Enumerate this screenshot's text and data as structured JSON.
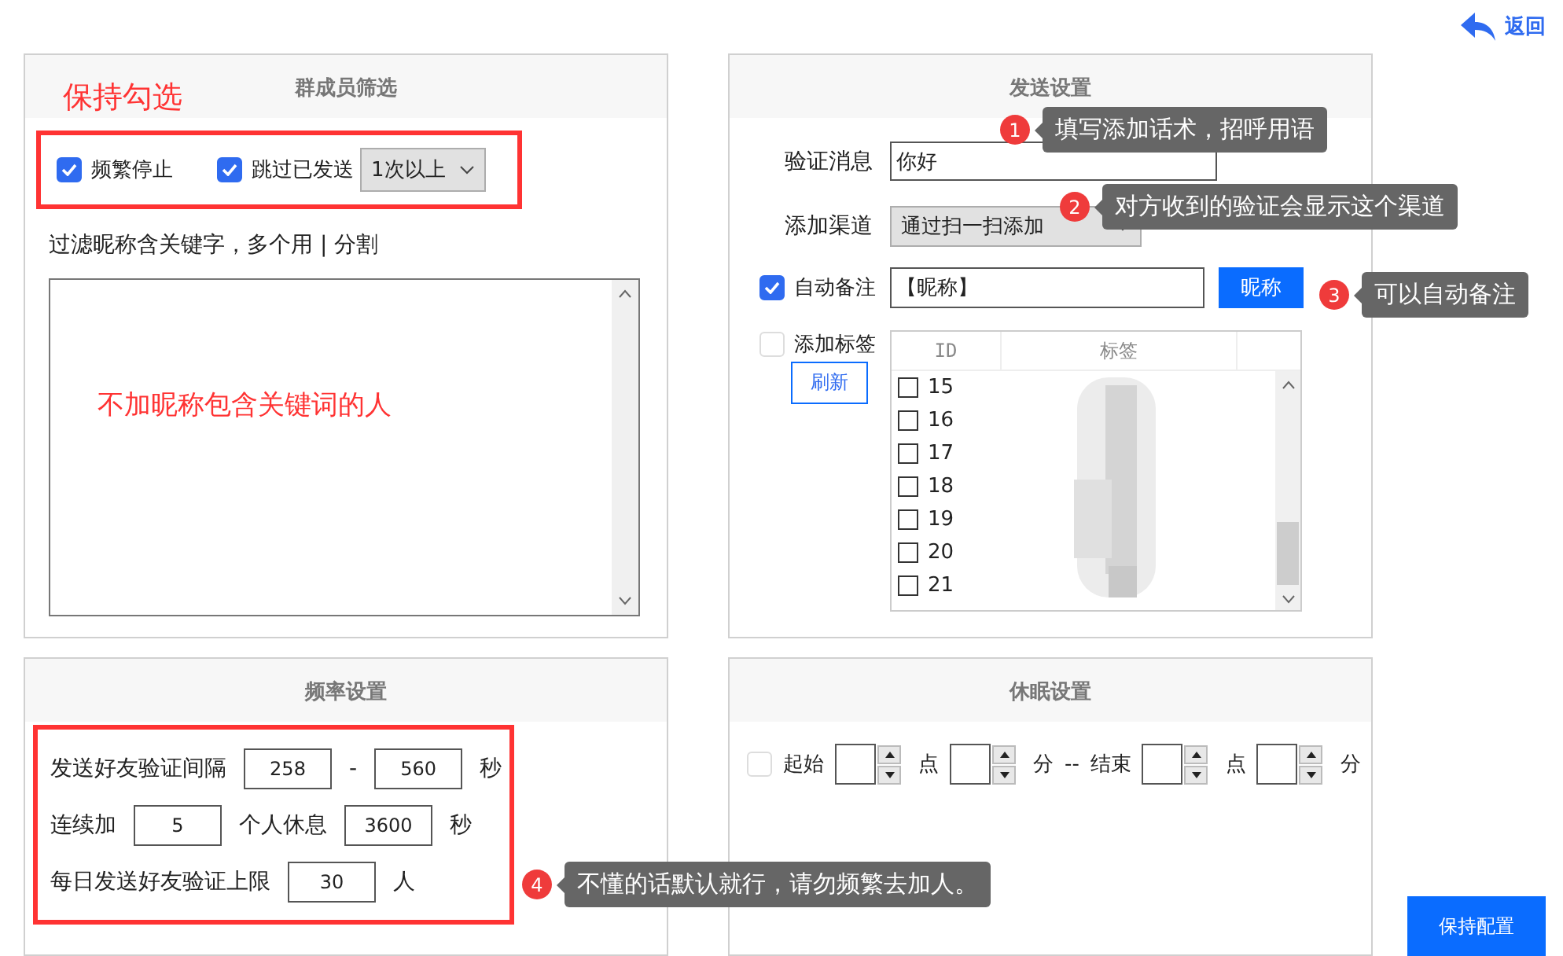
{
  "back_link": "返回",
  "member_filter": {
    "title": "群成员筛选",
    "hint": "保持勾选",
    "options": [
      {
        "label": "频繁停止",
        "checked": true
      },
      {
        "label": "跳过已发送",
        "checked": true
      }
    ],
    "skip_select": "1次以上",
    "keyword_label": "过滤昵称含关键字，多个用 | 分割",
    "keyword_note": "不加昵称包含关键词的人"
  },
  "send_settings": {
    "title": "发送设置",
    "verify_label": "验证消息",
    "verify_value": "你好",
    "channel_label": "添加渠道",
    "channel_value": "通过扫一扫添加",
    "auto_remark": {
      "label": "自动备注",
      "checked": true,
      "value": "【昵称】",
      "button": "昵称"
    },
    "add_tag": {
      "label": "添加标签",
      "checked": false,
      "refresh": "刷新"
    },
    "tag_table": {
      "columns": [
        "ID",
        "标签"
      ],
      "rows": [
        {
          "id": "15",
          "checked": false
        },
        {
          "id": "16",
          "checked": false
        },
        {
          "id": "17",
          "checked": false
        },
        {
          "id": "18",
          "checked": false
        },
        {
          "id": "19",
          "checked": false
        },
        {
          "id": "20",
          "checked": false
        },
        {
          "id": "21",
          "checked": false
        }
      ]
    }
  },
  "frequency": {
    "title": "频率设置",
    "rows": [
      {
        "parts": [
          {
            "kind": "text",
            "text": "发送好友验证间隔"
          },
          {
            "kind": "input",
            "value": "258"
          },
          {
            "kind": "text",
            "text": "-"
          },
          {
            "kind": "input",
            "value": "560"
          },
          {
            "kind": "text",
            "text": "秒"
          }
        ]
      },
      {
        "parts": [
          {
            "kind": "text",
            "text": "连续加"
          },
          {
            "kind": "input",
            "value": "5"
          },
          {
            "kind": "text",
            "text": "个人休息"
          },
          {
            "kind": "input",
            "value": "3600"
          },
          {
            "kind": "text",
            "text": "秒"
          }
        ]
      },
      {
        "parts": [
          {
            "kind": "text",
            "text": "每日发送好友验证上限"
          },
          {
            "kind": "input",
            "value": "30"
          },
          {
            "kind": "text",
            "text": "人"
          }
        ]
      }
    ]
  },
  "sleep": {
    "title": "休眠设置",
    "enabled": false,
    "parts": [
      {
        "kind": "text",
        "text": "起始"
      },
      {
        "kind": "spin"
      },
      {
        "kind": "text",
        "text": "点"
      },
      {
        "kind": "spin"
      },
      {
        "kind": "text",
        "text": "分"
      },
      {
        "kind": "text",
        "text": "--"
      },
      {
        "kind": "text",
        "text": "结束"
      },
      {
        "kind": "spin"
      },
      {
        "kind": "text",
        "text": "点"
      },
      {
        "kind": "spin"
      },
      {
        "kind": "text",
        "text": "分"
      }
    ]
  },
  "callouts": [
    {
      "number": "1",
      "text": "填写添加话术，招呼用语"
    },
    {
      "number": "2",
      "text": "对方收到的验证会显示这个渠道"
    },
    {
      "number": "3",
      "text": "可以自动备注"
    },
    {
      "number": "4",
      "text": "不懂的话默认就行，请勿频繁去加人。"
    }
  ],
  "save_button": "保持配置"
}
